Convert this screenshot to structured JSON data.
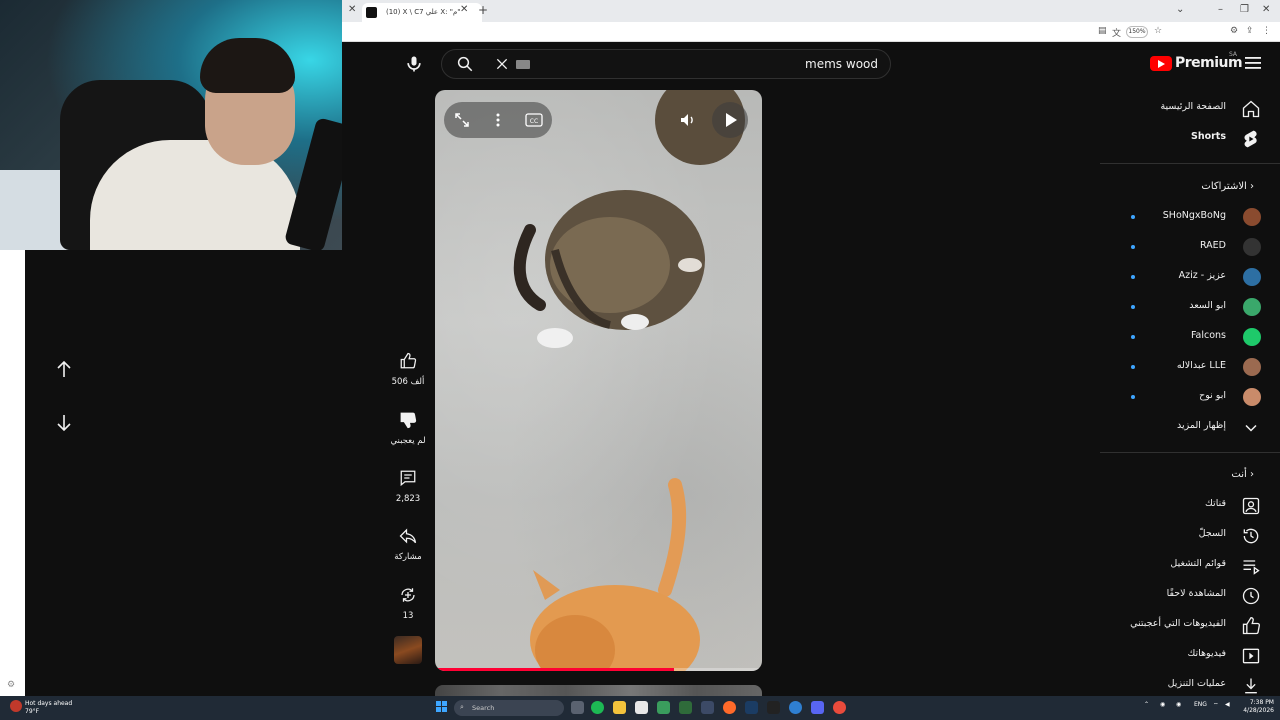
{
  "browser": {
    "tab_title": "(10) X \\ C7 علي X: \"م\"",
    "zoom": "150%"
  },
  "masthead": {
    "search_query": "mems wood",
    "logo_text": "Premium",
    "country_code": "SA"
  },
  "short": {
    "likes": "506 ألف",
    "dislike_label": "لم يعجبني",
    "comments": "2,823",
    "share_label": "مشاركة",
    "remix_count": "13",
    "progress_fraction": 0.73
  },
  "sidebar": {
    "main_items": [
      {
        "label": "الصفحة الرئيسية",
        "icon": "home-icon"
      },
      {
        "label": "Shorts",
        "icon": "shorts-icon"
      }
    ],
    "subscriptions_header": "الاشتراكات",
    "subscriptions": [
      {
        "label": "SHoNgxBoNg",
        "color": "#8a4b2f"
      },
      {
        "label": "RAED",
        "color": "#333333"
      },
      {
        "label": "Aziz - عزيز",
        "color": "#2d6fa3"
      },
      {
        "label": "ابو السعد",
        "color": "#3aa86b"
      },
      {
        "label": "Falcons",
        "color": "#1ec96a"
      },
      {
        "label": "عبدالاله LLE",
        "color": "#9b6a50"
      },
      {
        "label": "ابو نوح",
        "color": "#c98b6a"
      }
    ],
    "show_more": "إظهار المزيد",
    "you_header": "أنت",
    "you_items": [
      {
        "label": "قناتك",
        "icon": "channel-icon"
      },
      {
        "label": "السجلّ",
        "icon": "history-icon"
      },
      {
        "label": "قوائم التشغيل",
        "icon": "playlists-icon"
      },
      {
        "label": "المشاهدة لاحقًا",
        "icon": "watch-later-icon"
      },
      {
        "label": "الفيديوهات التي أعجبتني",
        "icon": "liked-icon"
      },
      {
        "label": "فيديوهاتك",
        "icon": "your-videos-icon"
      },
      {
        "label": "عمليات التنزيل",
        "icon": "downloads-icon"
      }
    ]
  },
  "taskbar": {
    "weather_title": "Hot days ahead",
    "weather_temp": "79°F",
    "search_placeholder": "Search",
    "language": "ENG",
    "time": "7:38 PM",
    "date": "4/28/2026"
  }
}
